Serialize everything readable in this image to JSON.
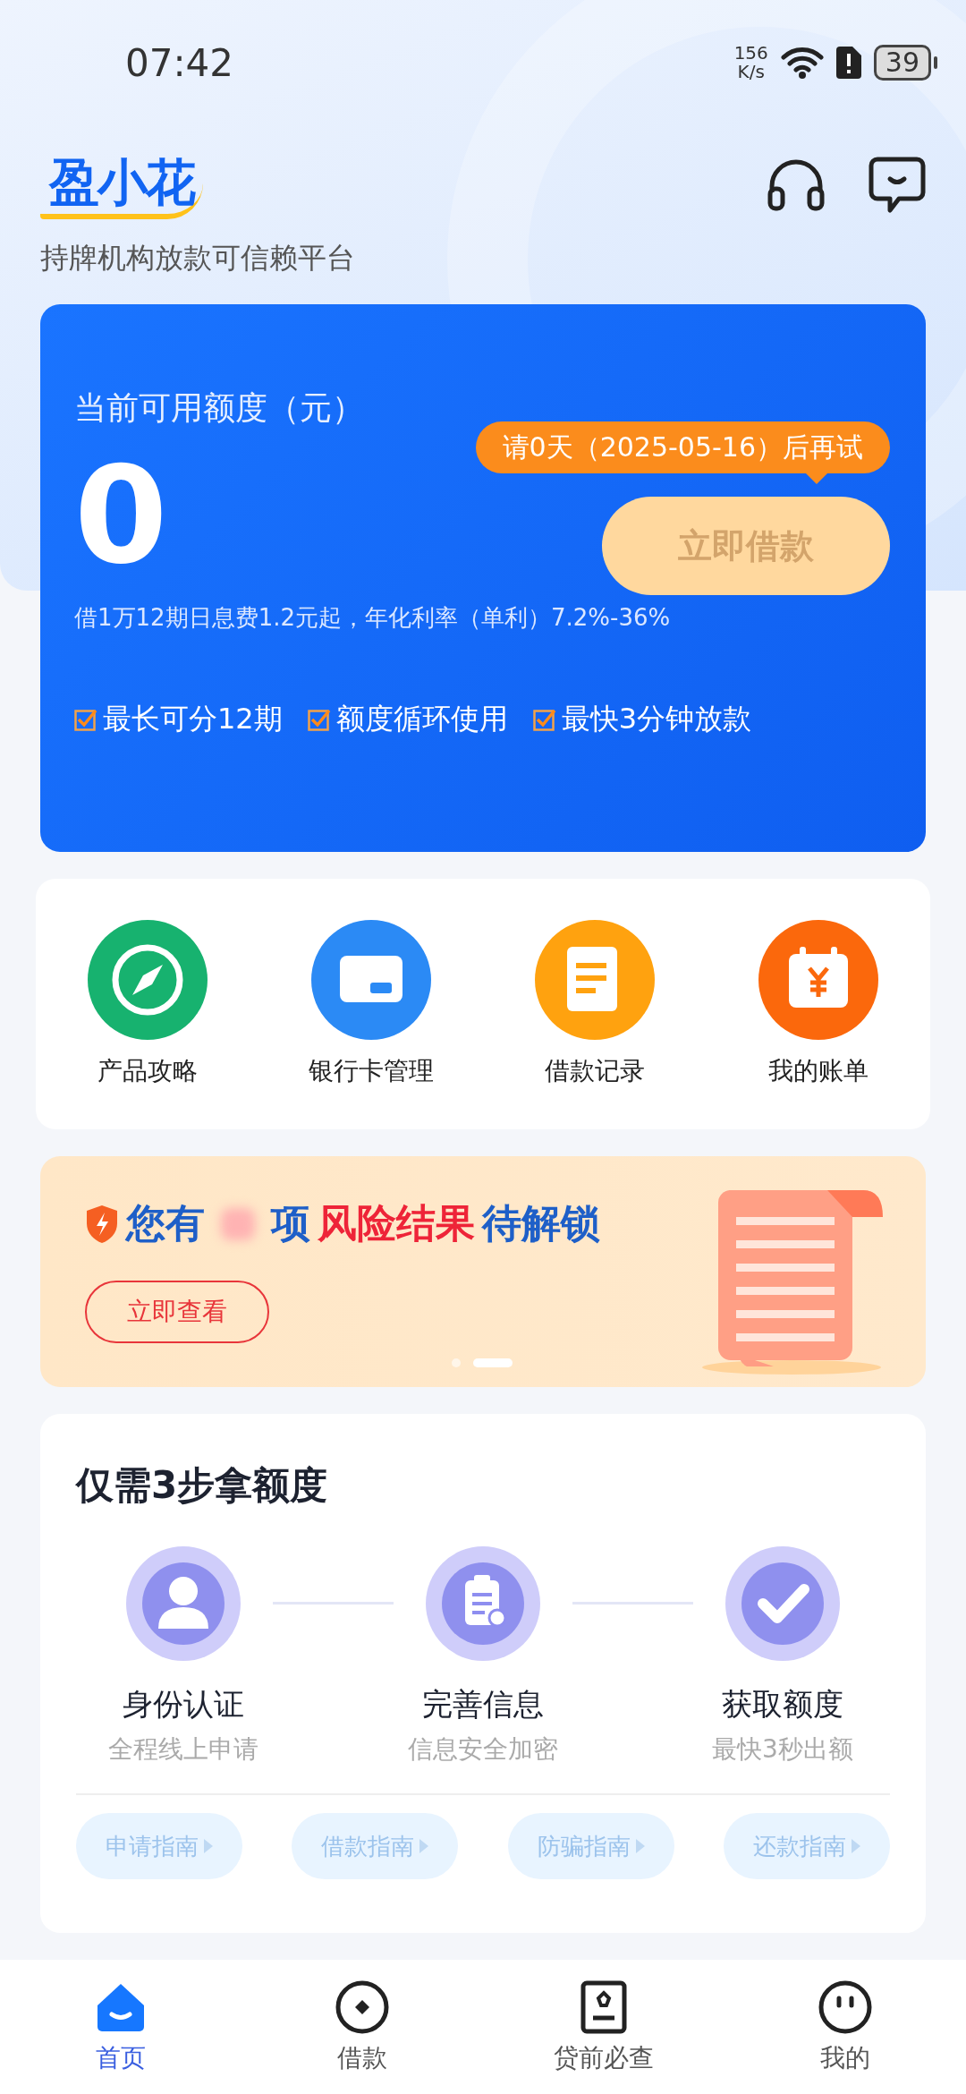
{
  "status_bar": {
    "time": "07:42",
    "net_speed": [
      "156",
      "K/s"
    ],
    "battery": "39"
  },
  "header": {
    "logo": "盈小花",
    "tagline": "持牌机构放款可信赖平台"
  },
  "credit_card": {
    "label": "当前可用额度（元）",
    "amount": "0",
    "tooltip": "请0天（2025-05-16）后再试",
    "button": {
      "label": "立即借款",
      "disabled": true
    },
    "rate_note": "借1万12期日息费1.2元起，年化利率（单利）7.2%-36%",
    "features": [
      {
        "label": "最长可分12期",
        "checked": true
      },
      {
        "label": "额度循环使用",
        "checked": true
      },
      {
        "label": "最快3分钟放款",
        "checked": true
      }
    ]
  },
  "shortcuts": [
    {
      "label": "产品攻略",
      "color": "#17b26f"
    },
    {
      "label": "银行卡管理",
      "color": "#2b8af5"
    },
    {
      "label": "借款记录",
      "color": "#ffa20f"
    },
    {
      "label": "我的账单",
      "color": "#fb680c"
    }
  ],
  "risk_banner": {
    "title": [
      {
        "kind": "plain",
        "text": "您有"
      },
      {
        "kind": "redacted"
      },
      {
        "kind": "plain",
        "text": "项"
      },
      {
        "kind": "highlight",
        "text": "风险结果"
      },
      {
        "kind": "plain",
        "text": "待解锁"
      }
    ],
    "button": "立即查看",
    "pages": [
      {
        "selected": false
      },
      {
        "selected": true
      }
    ]
  },
  "steps": {
    "title": "仅需3步拿额度",
    "items": [
      {
        "title": "身份认证",
        "subtitle": "全程线上申请"
      },
      {
        "title": "完善信息",
        "subtitle": "信息安全加密"
      },
      {
        "title": "获取额度",
        "subtitle": "最快3秒出额"
      }
    ],
    "guides": [
      "申请指南",
      "借款指南",
      "防骗指南",
      "还款指南"
    ]
  },
  "tab_bar": [
    {
      "label": "首页",
      "selected": true
    },
    {
      "label": "借款",
      "selected": false
    },
    {
      "label": "贷前必查",
      "selected": false
    },
    {
      "label": "我的",
      "selected": false
    }
  ]
}
